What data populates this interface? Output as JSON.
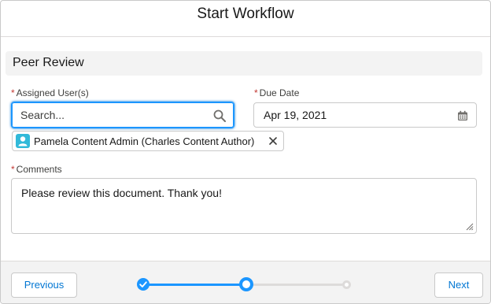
{
  "header": {
    "title": "Start Workflow"
  },
  "section": {
    "title": "Peer Review"
  },
  "fields": {
    "assigned_users": {
      "required_marker": "*",
      "label": "Assigned User(s)",
      "placeholder": "Search...",
      "selected": [
        {
          "label": "Pamela Content Admin (Charles Content Author)",
          "icon": "user-icon"
        }
      ]
    },
    "due_date": {
      "required_marker": "*",
      "label": "Due Date",
      "value": "Apr 19, 2021",
      "icon": "calendar-icon"
    },
    "comments": {
      "required_marker": "*",
      "label": "Comments",
      "value": "Please review this document. Thank you!"
    }
  },
  "footer": {
    "previous_label": "Previous",
    "next_label": "Next",
    "progress": {
      "total_steps": 3,
      "current_step": 2
    }
  },
  "colors": {
    "accent": "#1b96ff",
    "link": "#0176d3",
    "required": "#c23934",
    "avatar": "#31b9d9"
  }
}
